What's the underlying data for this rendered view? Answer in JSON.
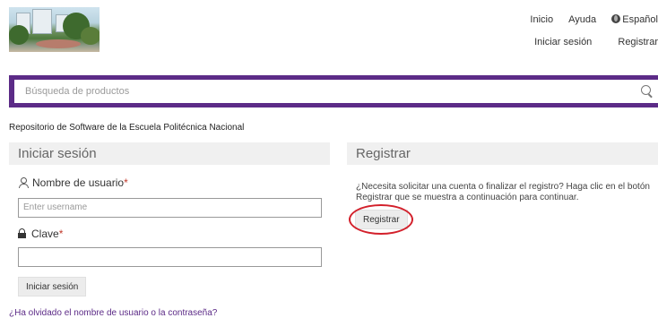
{
  "header": {
    "nav": {
      "home": "Inicio",
      "help": "Ayuda",
      "language": "Español"
    },
    "account": {
      "login": "Iniciar sesión",
      "register": "Registrar"
    }
  },
  "search": {
    "placeholder": "Búsqueda de productos",
    "icon": "search-icon"
  },
  "repository_title": "Repositorio de Software de la Escuela Politécnica Nacional",
  "login": {
    "heading": "Iniciar sesión",
    "username_label": "Nombre de usuario",
    "username_placeholder": "Enter username",
    "password_label": "Clave",
    "required_mark": "*",
    "submit": "Iniciar sesión",
    "forgot": "¿Ha olvidado el nombre de usuario o la contraseña?"
  },
  "register": {
    "heading": "Registrar",
    "description": "¿Necesita solicitar una cuenta o finalizar el registro? Haga clic en el botón Registrar que se muestra a continuación para continuar.",
    "button": "Registrar"
  },
  "colors": {
    "brand": "#5c2b87",
    "highlight_circle": "#d3202b",
    "required": "#c0392b"
  }
}
